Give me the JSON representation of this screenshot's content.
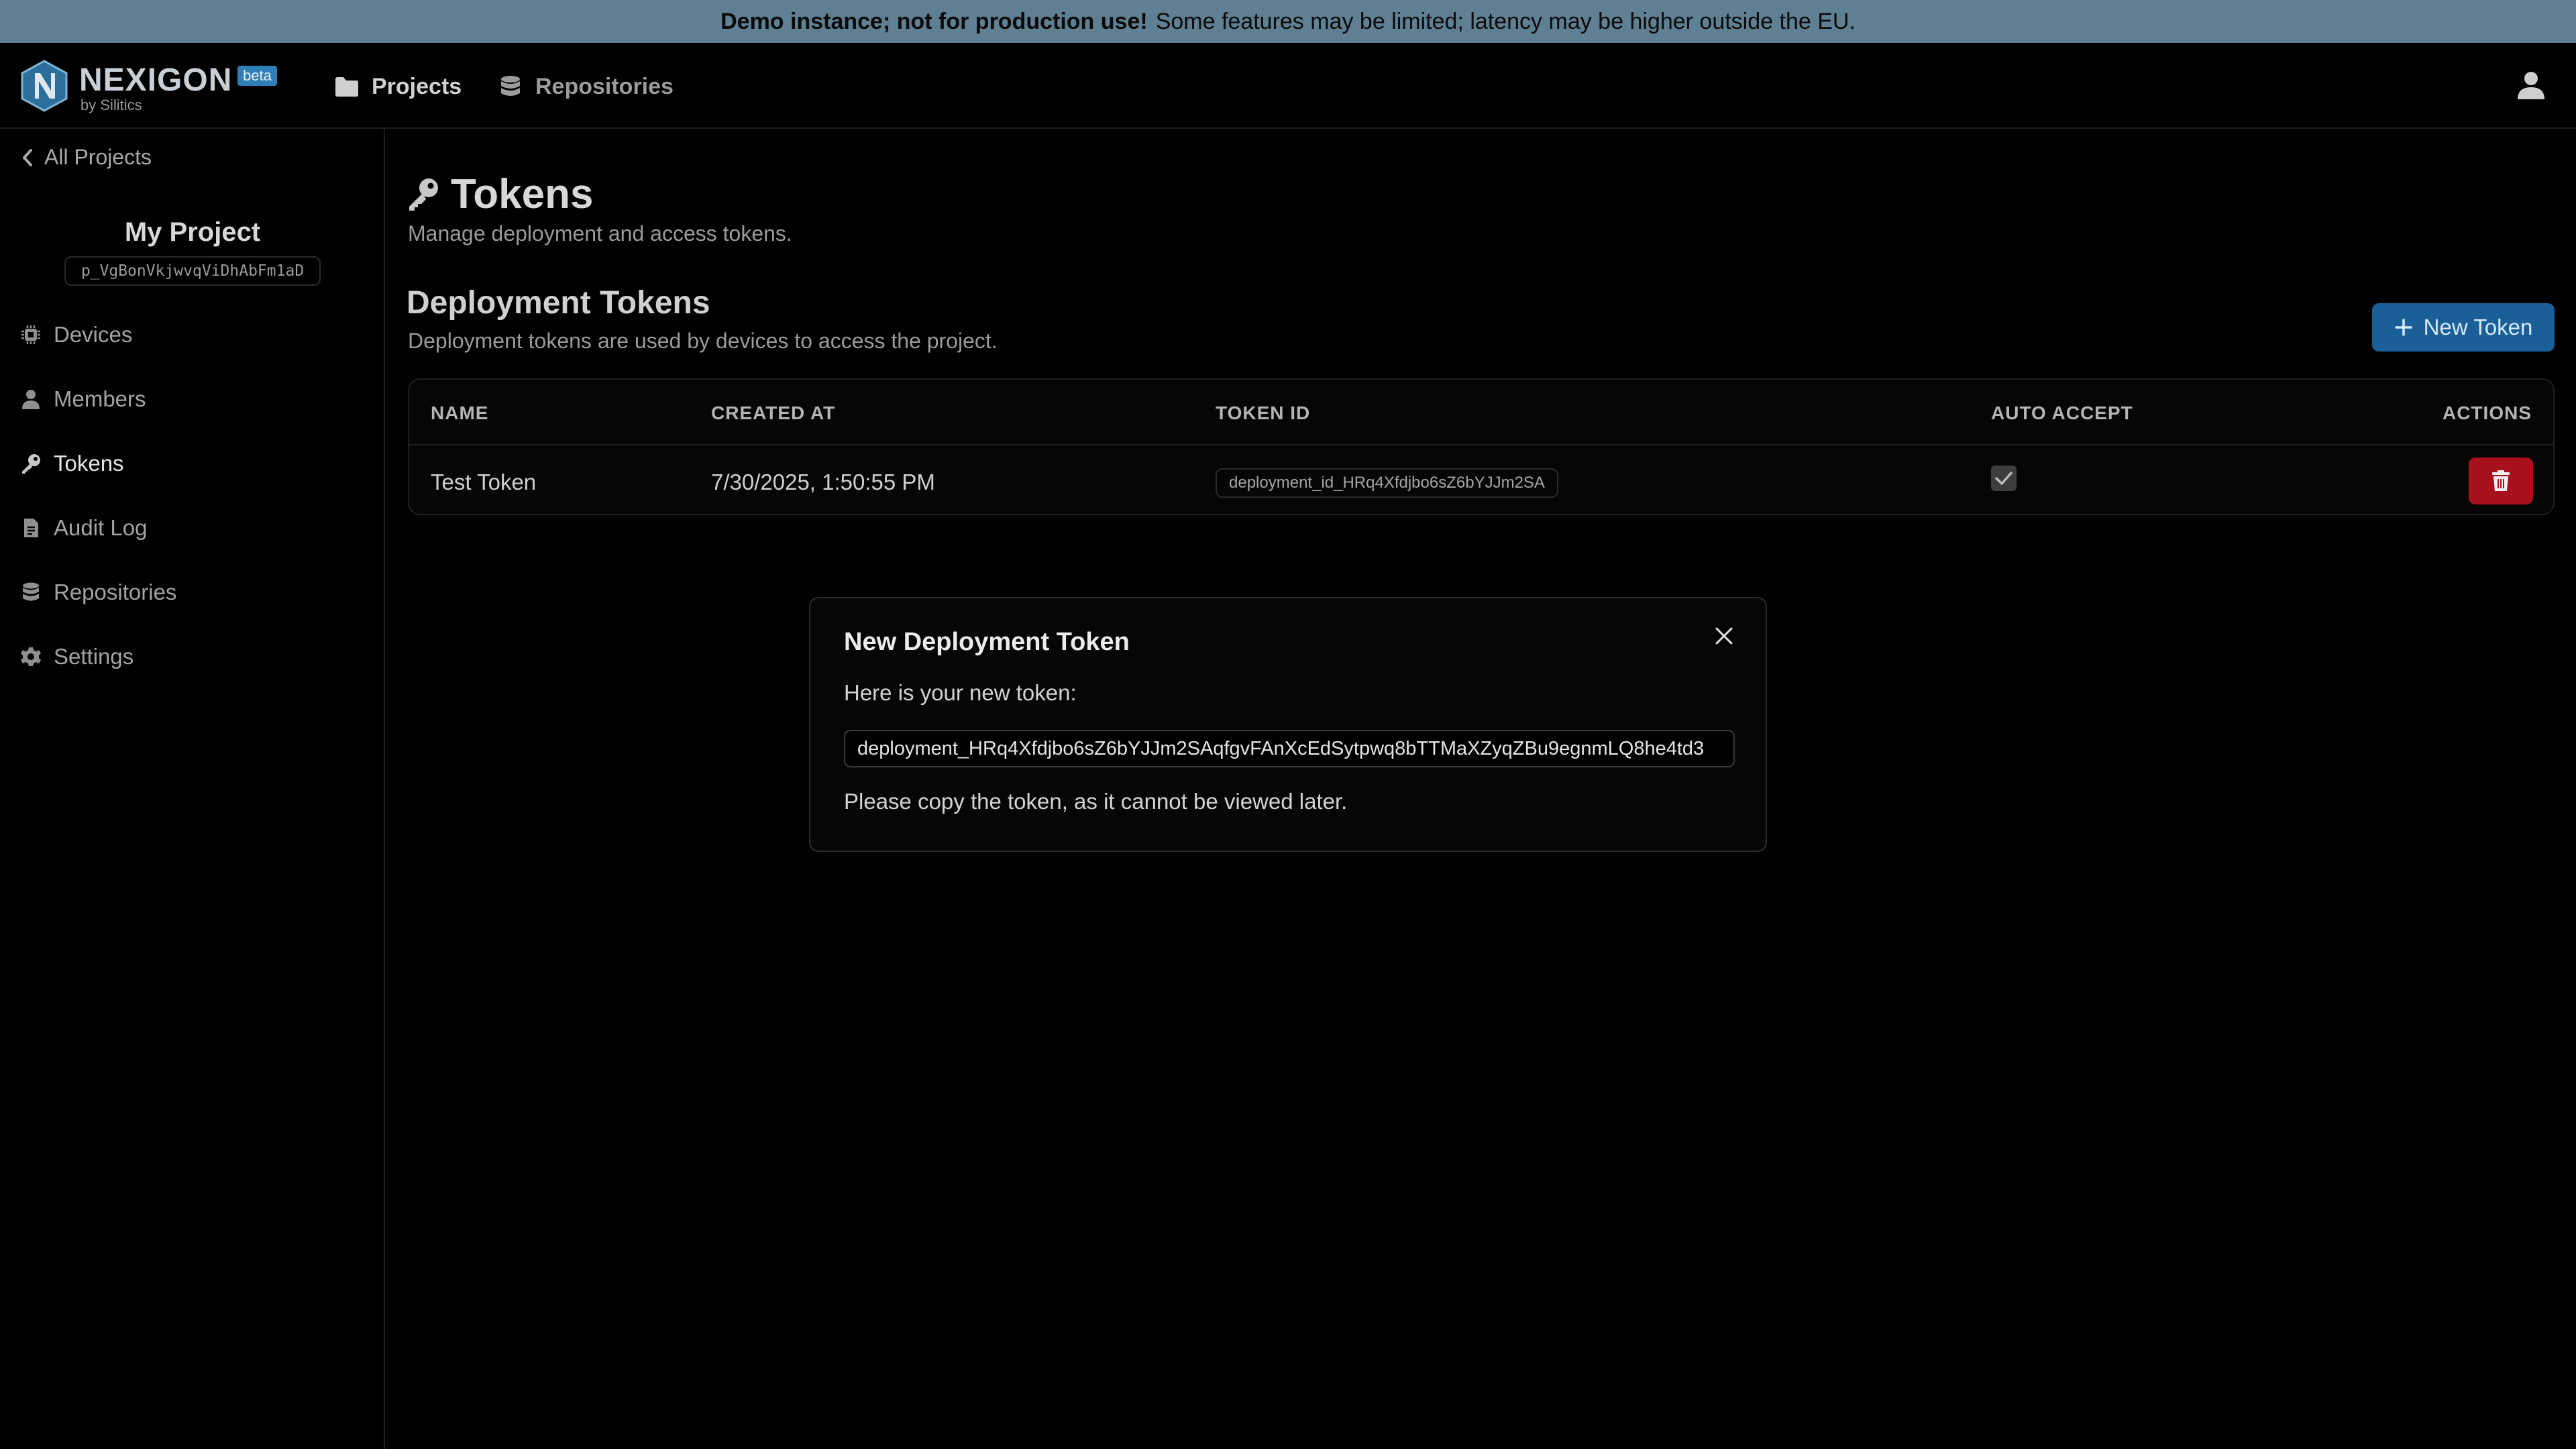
{
  "banner": {
    "bold": "Demo instance; not for production use!",
    "rest": "Some features may be limited; latency may be higher outside the EU."
  },
  "header": {
    "logo_text": "NEXIGON",
    "logo_sub": "by Silitics",
    "logo_badge": "beta",
    "nav": [
      {
        "label": "Projects",
        "icon": "folder-icon"
      },
      {
        "label": "Repositories",
        "icon": "database-icon"
      }
    ]
  },
  "sidebar": {
    "back_label": "All Projects",
    "project_name": "My Project",
    "project_id": "p_VgBonVkjwvqViDhAbFm1aD",
    "items": [
      {
        "label": "Devices",
        "icon": "chip-icon"
      },
      {
        "label": "Members",
        "icon": "user-icon"
      },
      {
        "label": "Tokens",
        "icon": "key-icon",
        "active": true
      },
      {
        "label": "Audit Log",
        "icon": "document-icon"
      },
      {
        "label": "Repositories",
        "icon": "database-icon"
      },
      {
        "label": "Settings",
        "icon": "gear-icon"
      }
    ]
  },
  "main": {
    "title": "Tokens",
    "subtitle": "Manage deployment and access tokens.",
    "section_title": "Deployment Tokens",
    "section_subtitle": "Deployment tokens are used by devices to access the project.",
    "new_token_label": "New Token"
  },
  "table": {
    "headers": {
      "name": "NAME",
      "created_at": "CREATED AT",
      "token_id": "TOKEN ID",
      "auto_accept": "AUTO ACCEPT",
      "actions": "ACTIONS"
    },
    "rows": [
      {
        "name": "Test Token",
        "created_at": "7/30/2025, 1:50:55 PM",
        "token_id": "deployment_id_HRq4Xfdjbo6sZ6bYJJm2SA",
        "auto_accept": true
      }
    ]
  },
  "modal": {
    "title": "New Deployment Token",
    "text": "Here is your new token:",
    "token_value": "deployment_HRq4Xfdjbo6sZ6bYJJm2SAqfgvFAnXcEdSytpwq8bTTMaXZyqZBu9egnmLQ8he4td3",
    "note": "Please copy the token, as it cannot be viewed later."
  },
  "colors": {
    "banner": "#5f7f92",
    "primary_button": "#1a5f97",
    "danger_button": "#a8101c",
    "background": "#000000"
  }
}
